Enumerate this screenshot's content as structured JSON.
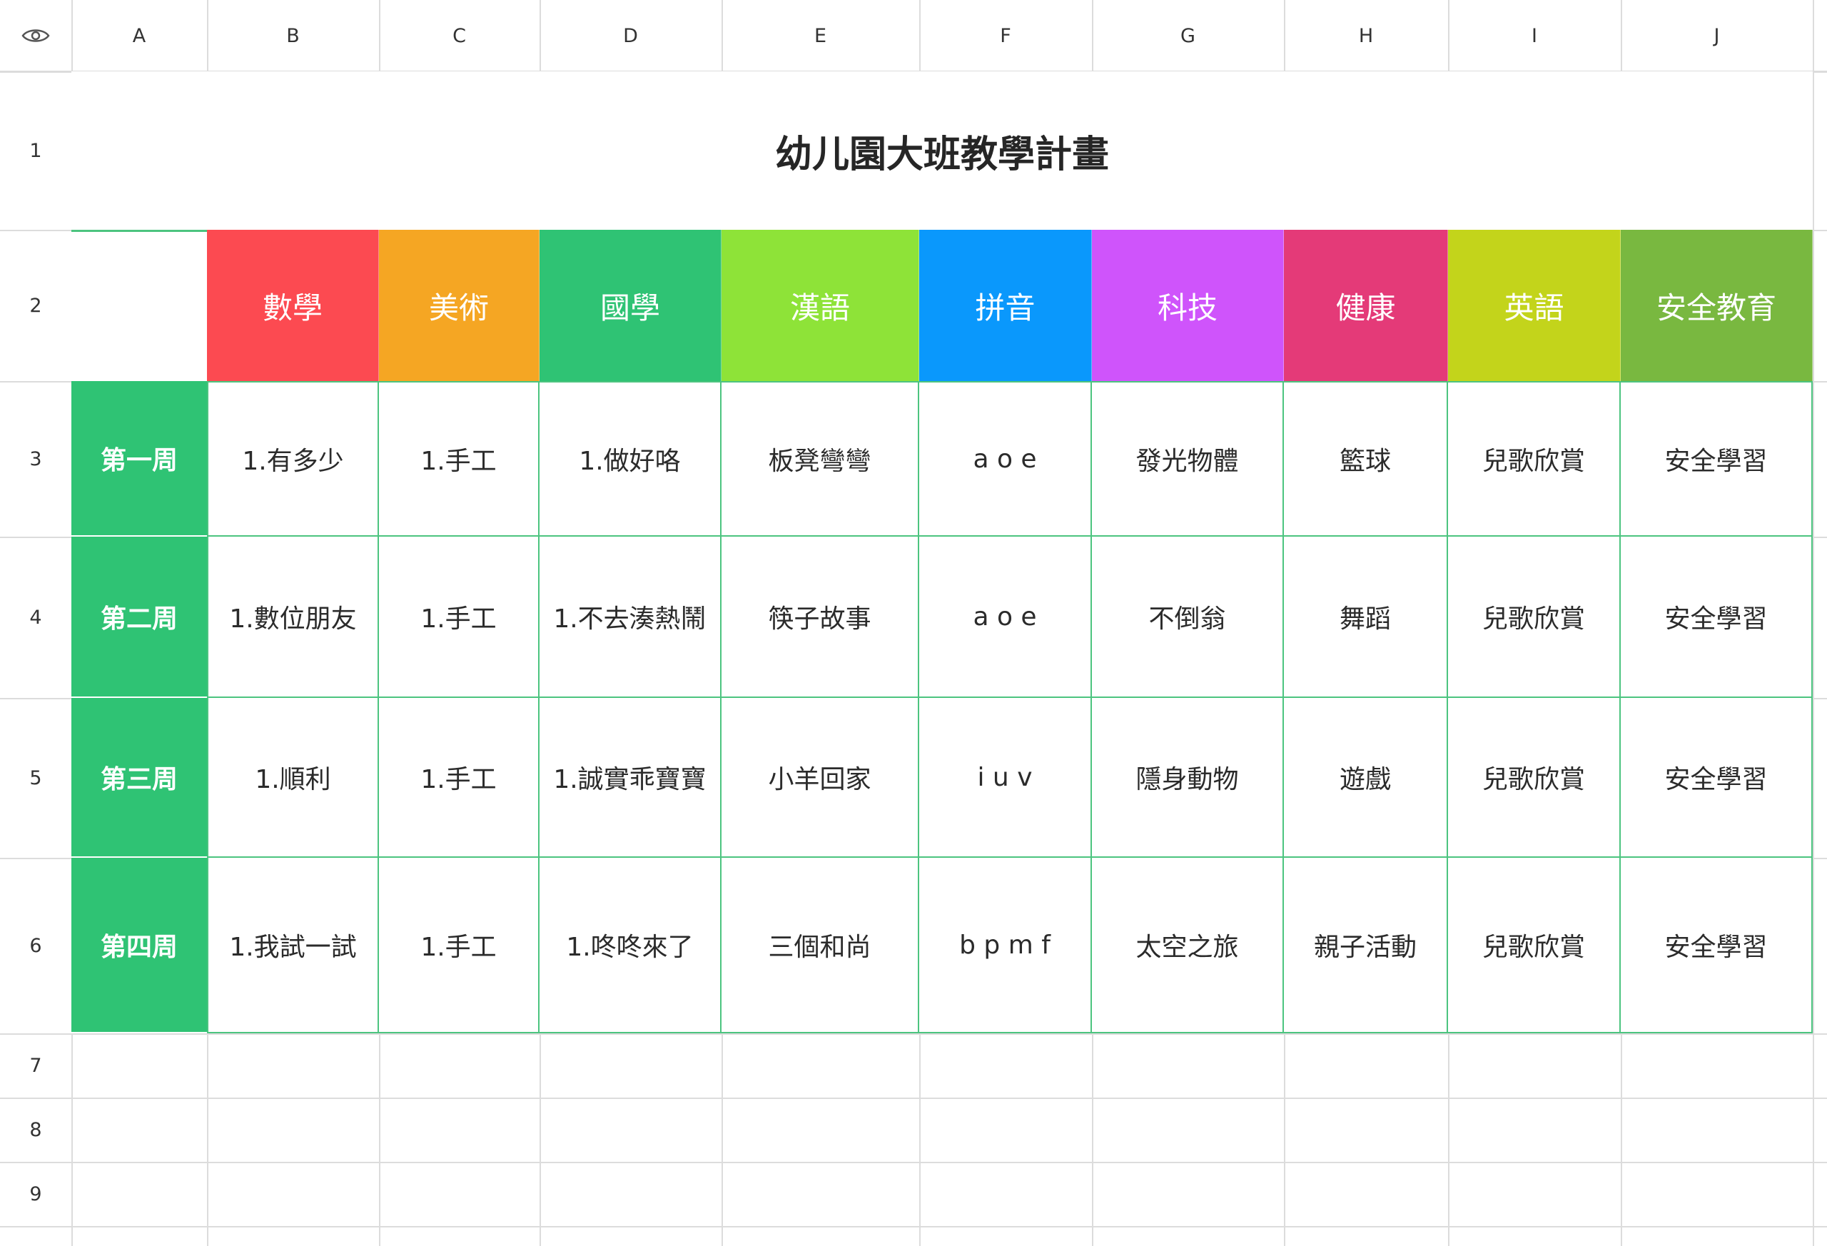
{
  "columns": [
    "A",
    "B",
    "C",
    "D",
    "E",
    "F",
    "G",
    "H",
    "I",
    "J"
  ],
  "rows": [
    "1",
    "2",
    "3",
    "4",
    "5",
    "6",
    "7",
    "8",
    "9"
  ],
  "title": "幼儿園大班教學計畫",
  "subjects": [
    {
      "label": "數學",
      "color": "#fc4a51"
    },
    {
      "label": "美術",
      "color": "#f5a623"
    },
    {
      "label": "國學",
      "color": "#2fc374"
    },
    {
      "label": "漢語",
      "color": "#8ee338"
    },
    {
      "label": "拼音",
      "color": "#0a98fc"
    },
    {
      "label": "科技",
      "color": "#cf54fb"
    },
    {
      "label": "健康",
      "color": "#e43a78"
    },
    {
      "label": "英語",
      "color": "#c3d41b"
    },
    {
      "label": "安全教育",
      "color": "#79b840"
    }
  ],
  "weeks": [
    {
      "label": "第一周",
      "cells": [
        "1.有多少",
        "1.手工",
        "1.做好咯",
        "板凳彎彎",
        "a o e",
        "發光物體",
        "籃球",
        "兒歌欣賞",
        "安全學習"
      ]
    },
    {
      "label": "第二周",
      "cells": [
        "1.數位朋友",
        "1.手工",
        "1.不去湊熱鬧",
        "筷子故事",
        "a o e",
        "不倒翁",
        "舞蹈",
        "兒歌欣賞",
        "安全學習"
      ]
    },
    {
      "label": "第三周",
      "cells": [
        "1.順利",
        "1.手工",
        "1.誠實乖寶寶",
        "小羊回家",
        "i u v",
        "隱身動物",
        "遊戲",
        "兒歌欣賞",
        "安全學習"
      ]
    },
    {
      "label": "第四周",
      "cells": [
        "1.我試一試",
        "1.手工",
        "1.咚咚來了",
        "三個和尚",
        "b p m f",
        "太空之旅",
        "親子活動",
        "兒歌欣賞",
        "安全學習"
      ]
    }
  ],
  "colors": {
    "week_bg": "#2fc374",
    "grid_border": "#4cc47f",
    "gridline": "#dcdcdc"
  },
  "corner_icon": "eye-icon"
}
